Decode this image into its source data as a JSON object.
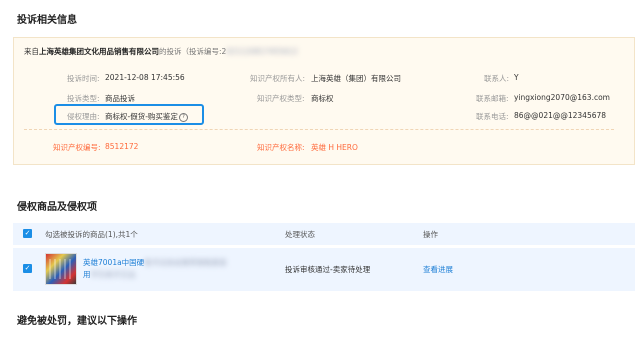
{
  "complaint_section": {
    "title": "投诉相关信息",
    "header_prefix": "来自",
    "company": "上海英雄集团文化用品销售有限公司",
    "header_suffix": "的投诉（投诉编号:2",
    "header_hidden": "021120817455612",
    "complaint_time_label": "投诉时间:",
    "complaint_time_value": "2021-12-08 17:45:56",
    "ip_owner_label": "知识产权所有人:",
    "ip_owner_value": "上海英雄（集团）有限公司",
    "contact_label": "联系人:",
    "contact_value": "Y",
    "complaint_type_label": "投诉类型:",
    "complaint_type_value": "商品投诉",
    "ip_type_label": "知识产权类型:",
    "ip_type_value": "商标权",
    "email_label": "联系邮箱:",
    "email_value": "yingxiong2070@163.com",
    "reason_label": "侵权理由:",
    "reason_value": "商标权-假货-购买鉴定",
    "help_glyph": "?",
    "phone_label": "联系电话:",
    "phone_value": "86@@021@@12345678",
    "ip_number_label": "知识产权编号:",
    "ip_number_value": "8512172",
    "ip_name_label": "知识产权名称:",
    "ip_name_value": "英雄 H HERO"
  },
  "products_section": {
    "title": "侵权商品及侵权项",
    "select_label": "勾选被投诉的商品(1),共1个",
    "status_col": "处理状态",
    "action_col": "操作",
    "check_glyph": "✓",
    "row": {
      "name_line1_visible": "英雄7001a中国硬",
      "name_line1_hidden": "笔书法协会推荐钢笔套装",
      "name_line2_visible": "用",
      "name_line2_hidden": "学生练字正品",
      "status": "投诉审核通过-卖家待处理",
      "action": "查看进展"
    }
  },
  "advice_section": {
    "title": "避免被处罚，建议以下操作"
  },
  "colors": {
    "accent_blue": "#1b8ee6",
    "orange": "#ff6a3c",
    "card_bg": "#fffaf0",
    "table_bg": "#eef5ff"
  }
}
